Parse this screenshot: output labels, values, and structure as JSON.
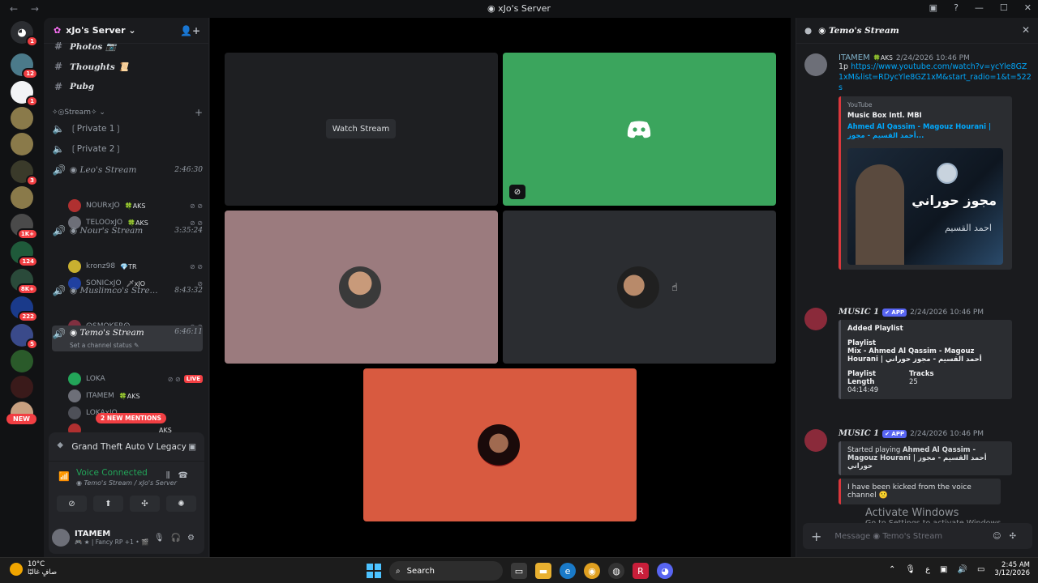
{
  "window": {
    "title": "xJo's Server",
    "nav": "← →"
  },
  "guilds": {
    "items": [
      {
        "badge": "1"
      },
      {
        "badge": "12"
      },
      {
        "badge": "1"
      },
      {
        "badge": ""
      },
      {
        "badge": ""
      },
      {
        "badge": "3"
      },
      {
        "badge": ""
      },
      {
        "badge": "1K+"
      },
      {
        "badge": "124"
      },
      {
        "badge": "8K+"
      },
      {
        "badge": "222"
      },
      {
        "badge": "5"
      },
      {
        "badge": ""
      },
      {
        "badge": ""
      }
    ],
    "new_label": "NEW"
  },
  "server": {
    "name": "xJo's Server ⌄"
  },
  "channels": {
    "photos": "Photos 📷",
    "thoughts": "Thoughts 📜",
    "pubg": "Pubg",
    "category": "✧◎Stream✧ ⌄",
    "private1": "❲Private 1❳",
    "private2": "❲Private 2❳",
    "leo": {
      "name": "◉ Leo's Stream",
      "time": "2:46:30"
    },
    "nour": {
      "name": "◉ Nour's Stream",
      "time": "3:35:24"
    },
    "muslimco": {
      "name": "◉ Muslimco's Stre...",
      "time": "8:43:32"
    },
    "temo": {
      "name": "◉ Temo's Stream",
      "time": "6:46:11",
      "status": "Set a channel status ✎"
    }
  },
  "members": {
    "leo": [
      {
        "name": "NOURxJO",
        "tag": "🍀AKS"
      },
      {
        "name": "TELOOxJO",
        "tag": "🍀AKS"
      }
    ],
    "nour": [
      {
        "name": "kronz98",
        "tag": "💎TR"
      },
      {
        "name": "SONICxJO",
        "tag": "🗡xJO"
      }
    ],
    "muslimco": [
      {
        "name": "ⵙSMOKERⵙ",
        "tag": ""
      }
    ],
    "temo": [
      {
        "name": "LOKA",
        "tag": "",
        "live": "LIVE"
      },
      {
        "name": "ITAMEM",
        "tag": "🍀AKS"
      },
      {
        "name": "LOKAxJO",
        "tag": ""
      },
      {
        "name": "",
        "tag": "AKS"
      }
    ],
    "mentions": "2 NEW MENTIONS"
  },
  "activity": {
    "game": "Grand Theft Auto V Legacy",
    "voice_status": "Voice Connected",
    "voice_sub": "◉ Temo's Stream / xJo's Server"
  },
  "user": {
    "name": "ITAMEM",
    "status": "🎮 ★ | Fancy RP +1 • 🎬"
  },
  "stage": {
    "watch_label": "Watch Stream"
  },
  "chat": {
    "title": "◉ Temo's Stream",
    "messages": [
      {
        "author": "ITAMEM",
        "tag": "🍀AKS",
        "time": "2/24/2026 10:46 PM",
        "text_prefix": "1p",
        "link": "https://www.youtube.com/watch?v=ycYle8GZ1xM&list=RDycYle8GZ1xM&start_radio=1&t=522s",
        "embed": {
          "provider": "YouTube",
          "author": "Music Box Intl. MBI",
          "title": "Ahmed Al Qassim - Magouz Hourani | أحمد القسيم - مجوز...",
          "thumb_text": "مجوز حوراني",
          "thumb_sub": "احمد القسيم"
        }
      },
      {
        "author": "MUSIC 1",
        "app": "✔ APP",
        "time": "2/24/2026 10:46 PM",
        "embed": {
          "title": "Added Playlist",
          "playlist_label": "Playlist",
          "playlist_value": "Mix - Ahmed Al Qassim - Magouz Hourani | أحمد القسيم - مجوز حوراني",
          "length_label": "Playlist Length",
          "length_value": "04:14:49",
          "tracks_label": "Tracks",
          "tracks_value": "25"
        }
      },
      {
        "author": "MUSIC 1",
        "app": "✔ APP",
        "time": "2/24/2026 10:46 PM",
        "started_prefix": "Started playing",
        "started_track": "Ahmed Al Qassim - Magouz Hourani | أحمد القسيم - مجوز حوراني",
        "kicked": "I have been kicked from the voice channel 🙁"
      }
    ],
    "watermark_title": "Activate Windows",
    "watermark_sub": "Go to Settings to activate Windows.",
    "placeholder": "Message ◉ Temo's Stream"
  },
  "taskbar": {
    "temp": "10°C",
    "weather": "صافٍ غالبًا",
    "search": "Search",
    "time": "2:45 AM",
    "date": "3/12/2026",
    "lang": "ع"
  },
  "colors": {
    "accent_green": "#23a559",
    "tile_green": "#3ba55d",
    "tile_mauve": "#9b7b7e",
    "tile_dark": "#2b2d31",
    "tile_orange": "#d85a40",
    "danger": "#f23f43",
    "blurple": "#5865f2"
  }
}
